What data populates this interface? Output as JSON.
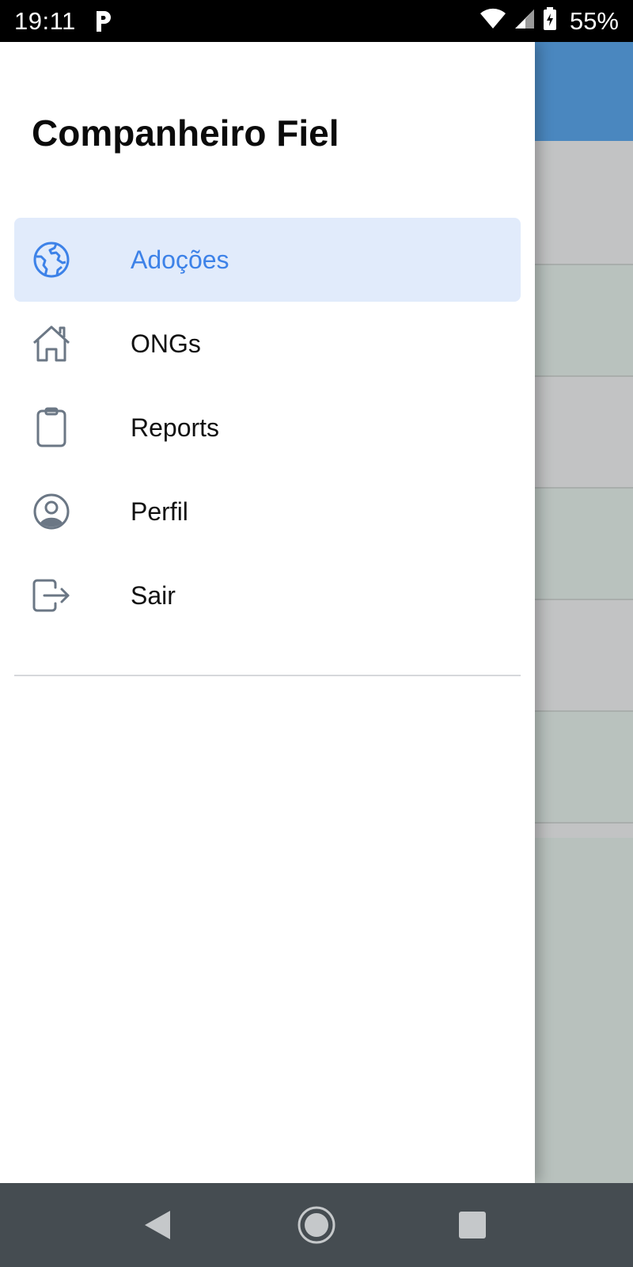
{
  "status_bar": {
    "time": "19:11",
    "battery": "55%",
    "icons": [
      "parking-icon",
      "wifi-icon",
      "signal-icon",
      "battery-icon"
    ]
  },
  "drawer": {
    "title": "Companheiro Fiel",
    "items": [
      {
        "label": "Adoções",
        "icon": "globe-icon",
        "active": true
      },
      {
        "label": "ONGs",
        "icon": "home-icon",
        "active": false
      },
      {
        "label": "Reports",
        "icon": "clipboard-icon",
        "active": false
      },
      {
        "label": "Perfil",
        "icon": "user-circle-icon",
        "active": false
      },
      {
        "label": "Sair",
        "icon": "logout-icon",
        "active": false
      }
    ]
  },
  "navigation_bar": {
    "buttons": [
      "back-icon",
      "home-circle-icon",
      "recents-icon"
    ]
  },
  "colors": {
    "accent": "#3d82e8",
    "active_bg": "#e1ebfb",
    "app_header": "#4a87bf",
    "icon_gray": "#6b7785",
    "nav_bar": "#454c51"
  }
}
